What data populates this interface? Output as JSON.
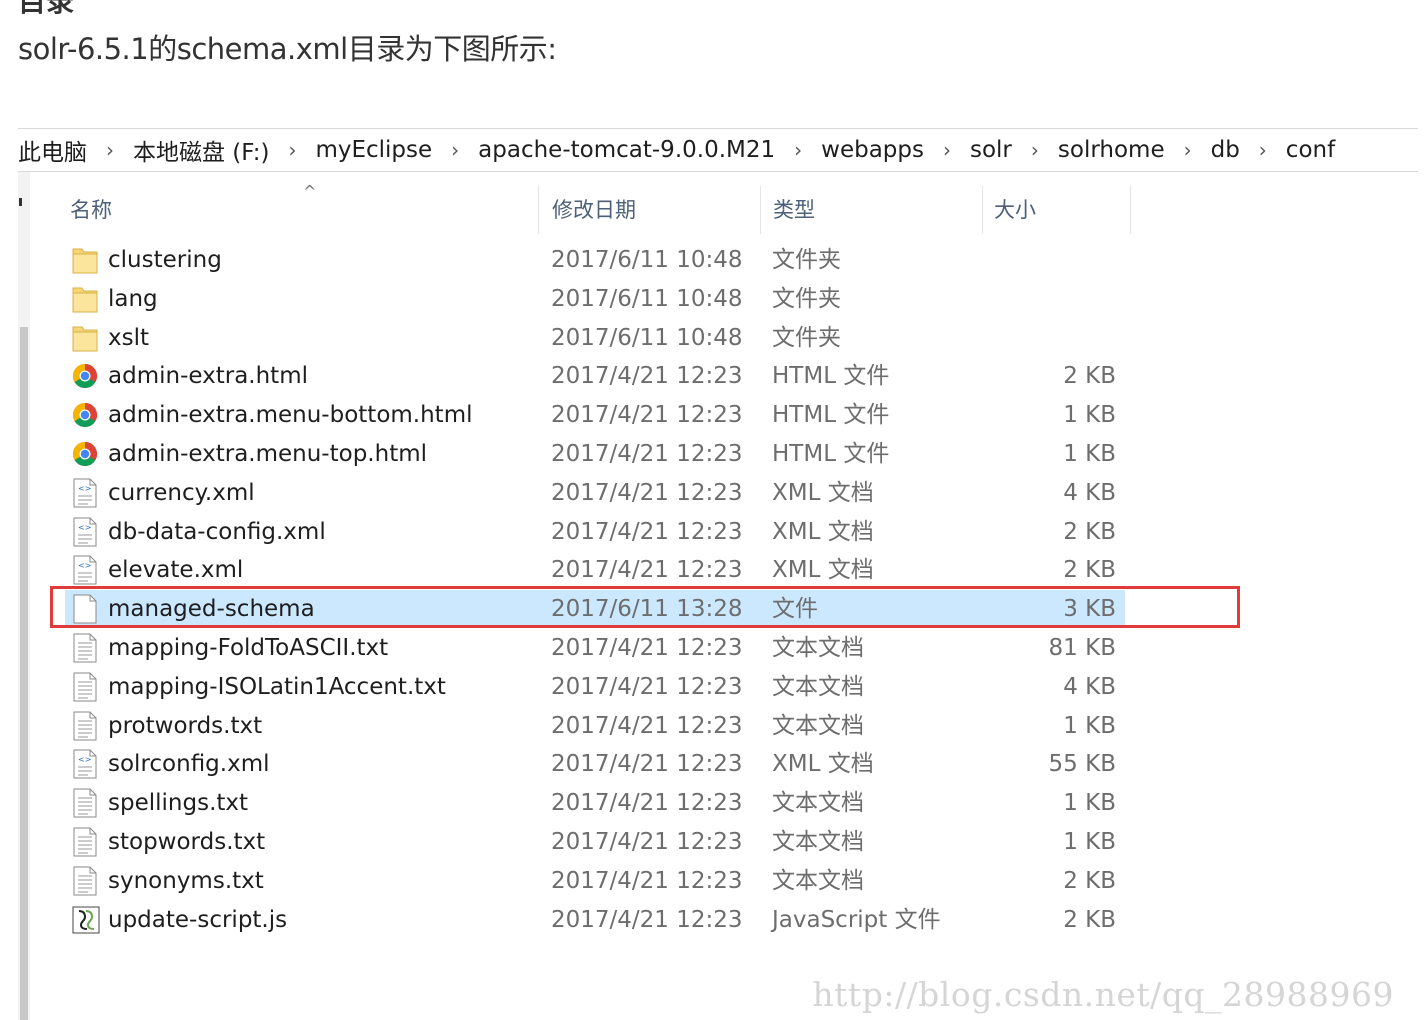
{
  "article": {
    "heading_partial": "目录",
    "caption": "solr-6.5.1的schema.xml目录为下图所示:"
  },
  "explorer": {
    "breadcrumb": [
      "此电脑",
      "本地磁盘 (F:)",
      "myEclipse",
      "apache-tomcat-9.0.0.M21",
      "webapps",
      "solr",
      "solrhome",
      "db",
      "conf"
    ],
    "breadcrumb_separator": "›",
    "columns": {
      "name": "名称",
      "date": "修改日期",
      "type": "类型",
      "size": "大小"
    },
    "sort_indicator": "^",
    "files": [
      {
        "name": "clustering",
        "date": "2017/6/11 10:48",
        "type": "文件夹",
        "size": "",
        "icon": "folder-icon"
      },
      {
        "name": "lang",
        "date": "2017/6/11 10:48",
        "type": "文件夹",
        "size": "",
        "icon": "folder-icon"
      },
      {
        "name": "xslt",
        "date": "2017/6/11 10:48",
        "type": "文件夹",
        "size": "",
        "icon": "folder-icon"
      },
      {
        "name": "admin-extra.html",
        "date": "2017/4/21 12:23",
        "type": "HTML 文件",
        "size": "2 KB",
        "icon": "chrome-icon"
      },
      {
        "name": "admin-extra.menu-bottom.html",
        "date": "2017/4/21 12:23",
        "type": "HTML 文件",
        "size": "1 KB",
        "icon": "chrome-icon"
      },
      {
        "name": "admin-extra.menu-top.html",
        "date": "2017/4/21 12:23",
        "type": "HTML 文件",
        "size": "1 KB",
        "icon": "chrome-icon"
      },
      {
        "name": "currency.xml",
        "date": "2017/4/21 12:23",
        "type": "XML 文档",
        "size": "4 KB",
        "icon": "xml-file-icon"
      },
      {
        "name": "db-data-config.xml",
        "date": "2017/4/21 12:23",
        "type": "XML 文档",
        "size": "2 KB",
        "icon": "xml-file-icon"
      },
      {
        "name": "elevate.xml",
        "date": "2017/4/21 12:23",
        "type": "XML 文档",
        "size": "2 KB",
        "icon": "xml-file-icon"
      },
      {
        "name": "managed-schema",
        "date": "2017/6/11 13:28",
        "type": "文件",
        "size": "3 KB",
        "icon": "blank-file-icon",
        "selected": true
      },
      {
        "name": "mapping-FoldToASCII.txt",
        "date": "2017/4/21 12:23",
        "type": "文本文档",
        "size": "81 KB",
        "icon": "text-file-icon"
      },
      {
        "name": "mapping-ISOLatin1Accent.txt",
        "date": "2017/4/21 12:23",
        "type": "文本文档",
        "size": "4 KB",
        "icon": "text-file-icon"
      },
      {
        "name": "protwords.txt",
        "date": "2017/4/21 12:23",
        "type": "文本文档",
        "size": "1 KB",
        "icon": "text-file-icon"
      },
      {
        "name": "solrconfig.xml",
        "date": "2017/4/21 12:23",
        "type": "XML 文档",
        "size": "55 KB",
        "icon": "xml-file-icon"
      },
      {
        "name": "spellings.txt",
        "date": "2017/4/21 12:23",
        "type": "文本文档",
        "size": "1 KB",
        "icon": "text-file-icon"
      },
      {
        "name": "stopwords.txt",
        "date": "2017/4/21 12:23",
        "type": "文本文档",
        "size": "1 KB",
        "icon": "text-file-icon"
      },
      {
        "name": "synonyms.txt",
        "date": "2017/4/21 12:23",
        "type": "文本文档",
        "size": "2 KB",
        "icon": "text-file-icon"
      },
      {
        "name": "update-script.js",
        "date": "2017/4/21 12:23",
        "type": "JavaScript 文件",
        "size": "2 KB",
        "icon": "script-file-icon"
      }
    ]
  },
  "watermark": "http://blog.csdn.net/qq_28988969",
  "colors": {
    "selection": "#cce8ff",
    "highlight_border": "#e03a3a",
    "header_text": "#4c607a"
  }
}
